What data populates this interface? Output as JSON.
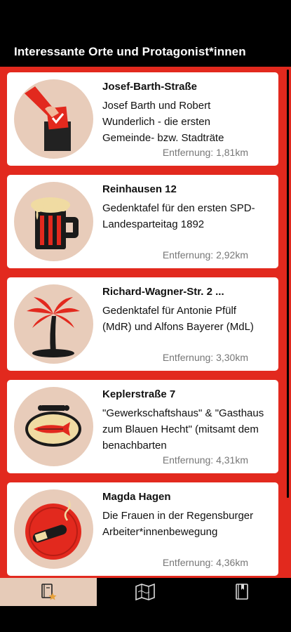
{
  "header": {
    "title": "Interessante Orte und Protagonist*innen"
  },
  "places": [
    {
      "title": "Josef-Barth-Straße",
      "description": "Josef Barth und Robert Wunderlich - die ersten Gemeinde- bzw. Stadträte",
      "distance": "Entfernung: 1,81km",
      "icon": "ballot-box-icon"
    },
    {
      "title": "Reinhausen 12",
      "description": "Gedenktafel für den ersten SPD-Landesparteitag 1892",
      "distance": "Entfernung: 2,92km",
      "icon": "beer-mug-icon"
    },
    {
      "title": "Richard-Wagner-Str. 2 ...",
      "description": "Gedenktafel für Antonie Pfülf (MdR) und Alfons Bayerer (MdL)",
      "distance": "Entfernung: 3,30km",
      "icon": "palm-tree-icon"
    },
    {
      "title": "Keplerstraße 7",
      "description": "\"Gewerkschaftshaus\" & \"Gasthaus zum Blauen Hecht\" (mitsamt dem benachbarten",
      "distance": "Entfernung: 4,31km",
      "icon": "pike-sign-icon"
    },
    {
      "title": "Magda Hagen",
      "description": "Die Frauen in der Regensburger Arbeiter*innenbewegung",
      "distance": "Entfernung: 4,36km",
      "icon": "cigar-icon"
    }
  ],
  "tabs": [
    {
      "icon": "bookmarked-places-icon",
      "active": true
    },
    {
      "icon": "map-icon",
      "active": false
    },
    {
      "icon": "book-icon",
      "active": false
    }
  ],
  "colors": {
    "accent": "#e2291e",
    "thumb_bg": "#e8ccba",
    "active_tab": "#e6cbb8"
  }
}
